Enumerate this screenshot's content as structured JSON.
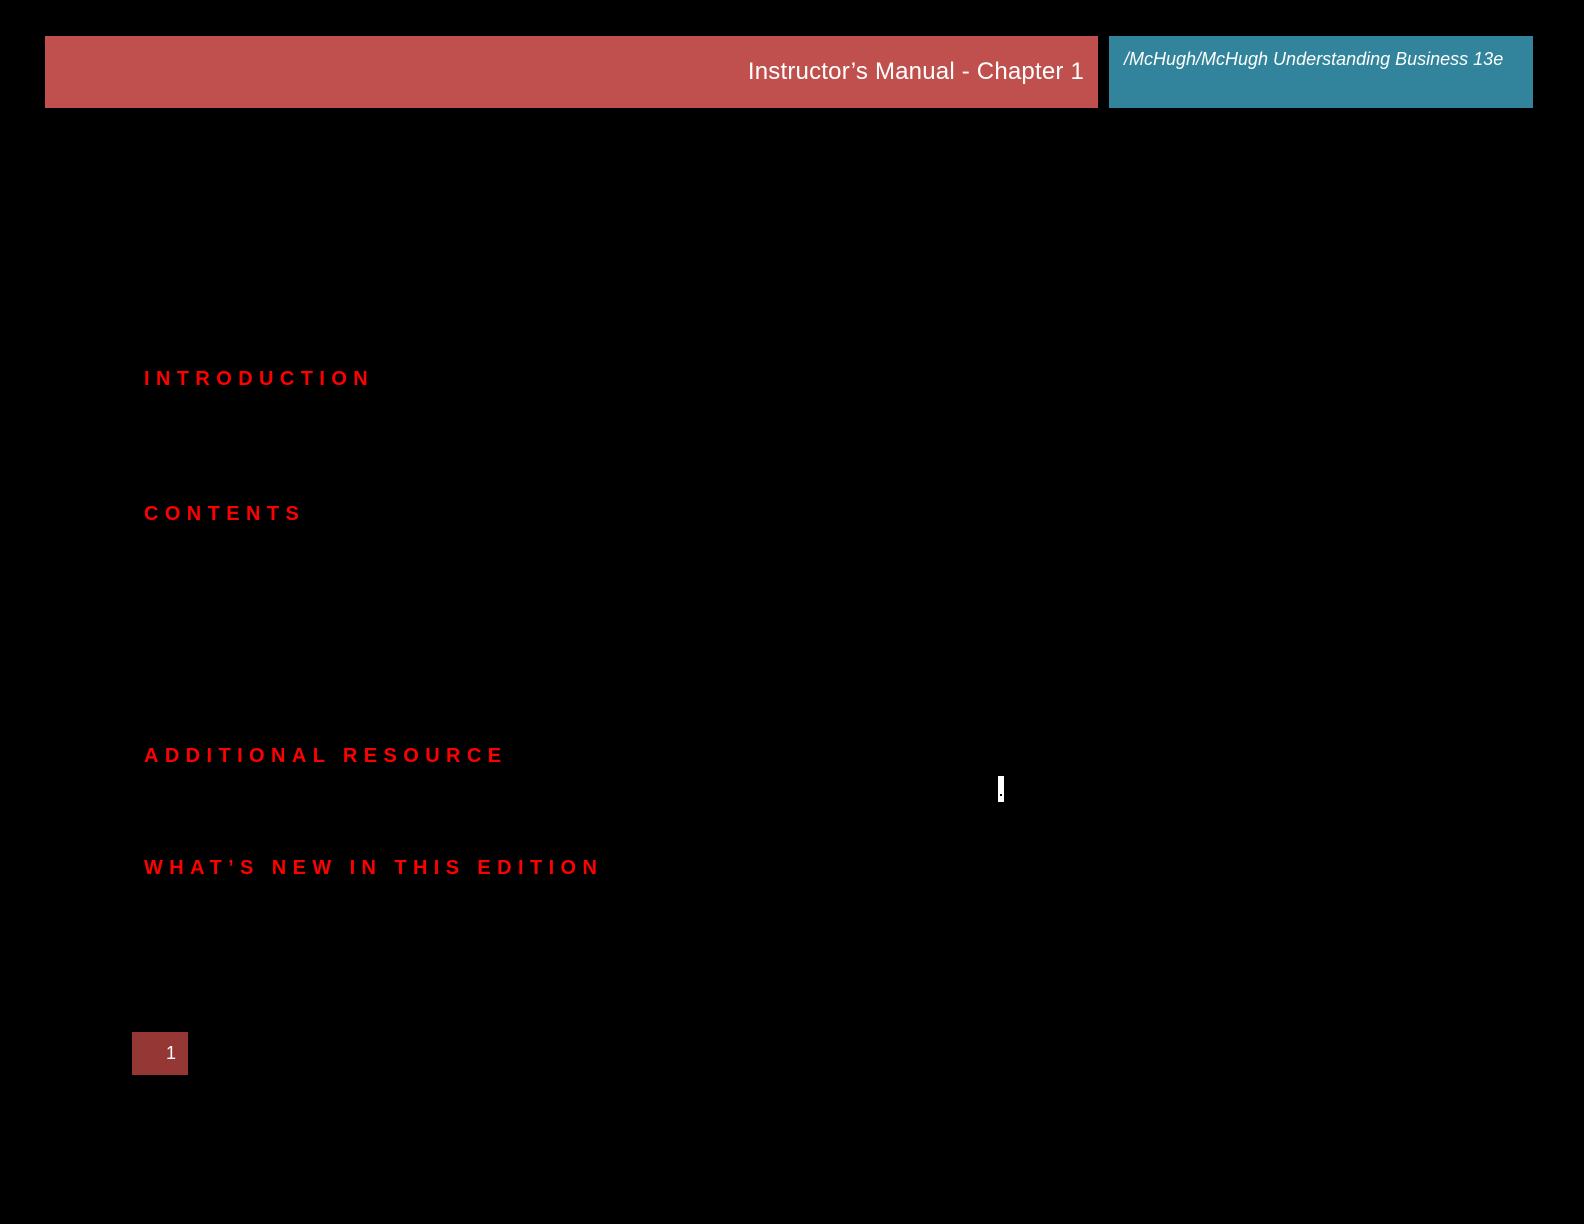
{
  "header": {
    "title": "Instructor’s Manual - Chapter 1",
    "book": "/McHugh/McHugh Understanding Business 13e"
  },
  "sections": {
    "introduction": "INTRODUCTION",
    "contents": "CONTENTS",
    "additional_resource": "ADDITIONAL RESOURCE",
    "whats_new": "WHAT’S NEW IN THIS EDITION"
  },
  "footer": {
    "page_number": "1"
  },
  "colors": {
    "background": "#000000",
    "header_red": "#c0504d",
    "header_teal": "#31849b",
    "heading_red": "#ff0000",
    "page_box": "#953735"
  }
}
